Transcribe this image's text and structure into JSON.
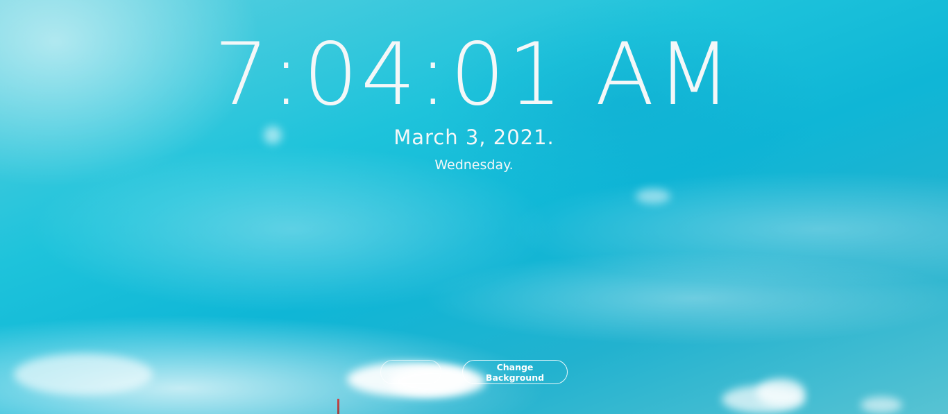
{
  "clock": {
    "time": "7:04:01 AM",
    "date": "March 3, 2021.",
    "weekday": "Wednesday."
  },
  "actions": {
    "change_background_label": "Change Background",
    "hidden_button_label": ""
  },
  "colors": {
    "sky": "#1ec3db",
    "text": "#f4f7f8",
    "button_border": "#ffffff"
  }
}
